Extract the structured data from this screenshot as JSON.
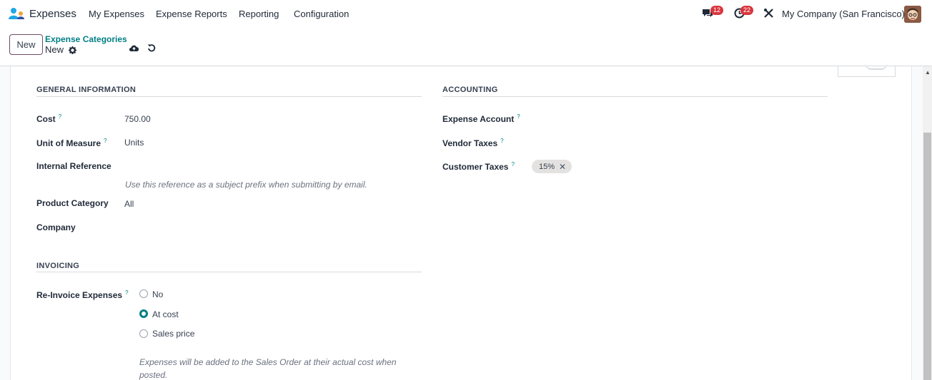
{
  "app": {
    "name": "Expenses"
  },
  "menu": [
    "My Expenses",
    "Expense Reports",
    "Reporting",
    "Configuration"
  ],
  "systray": {
    "messages_count": "12",
    "activities_count": "22",
    "company": "My Company (San Francisco)"
  },
  "control_panel": {
    "new_label": "New",
    "breadcrumb": "Expense Categories",
    "record_name": "New"
  },
  "general": {
    "title": "GENERAL INFORMATION",
    "cost_label": "Cost",
    "cost_value": "750.00",
    "uom_label": "Unit of Measure",
    "uom_value": "Units",
    "ref_label": "Internal Reference",
    "ref_hint": "Use this reference as a subject prefix when submitting by email.",
    "category_label": "Product Category",
    "category_value": "All",
    "company_label": "Company"
  },
  "accounting": {
    "title": "ACCOUNTING",
    "expense_account_label": "Expense Account",
    "vendor_taxes_label": "Vendor Taxes",
    "customer_taxes_label": "Customer Taxes",
    "customer_tax_tag": "15%"
  },
  "invoicing": {
    "title": "INVOICING",
    "reinvoice_label": "Re-Invoice Expenses",
    "options": [
      "No",
      "At cost",
      "Sales price"
    ],
    "selected": "At cost",
    "hint_line1": "Expenses will be added to the Sales Order at their actual cost when",
    "hint_line2": "posted."
  },
  "help_marker": "?",
  "colors": {
    "accent": "#017e84",
    "brand": "#714b67",
    "badge": "#d9363e"
  }
}
